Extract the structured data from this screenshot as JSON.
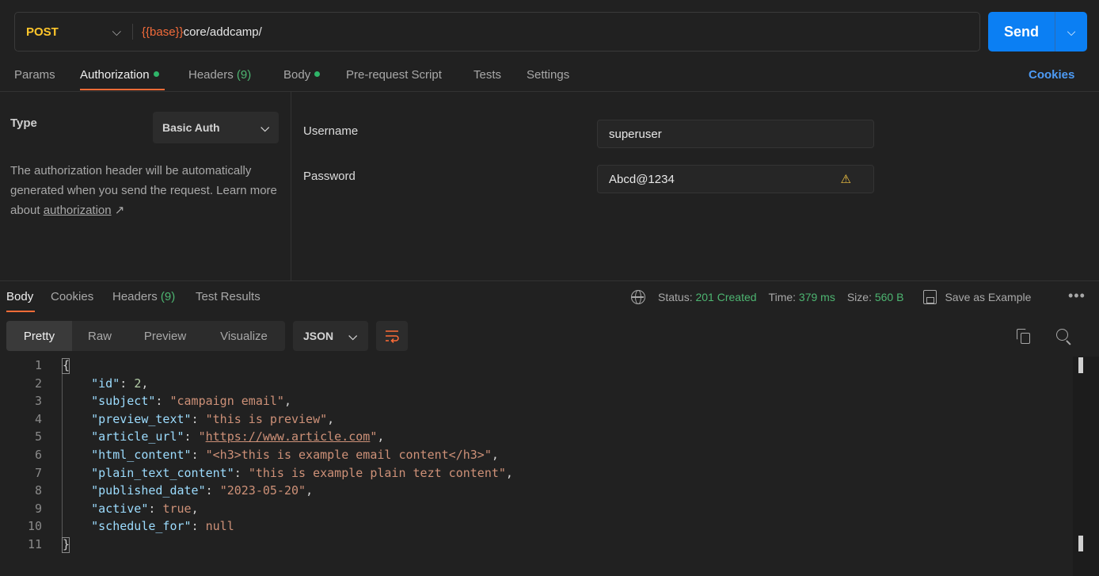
{
  "request": {
    "method": "POST",
    "url_var": "{{base}}",
    "url_path": "core/addcamp/",
    "send_label": "Send"
  },
  "req_tabs": {
    "params": "Params",
    "authorization": "Authorization",
    "headers": "Headers",
    "headers_count": "(9)",
    "body": "Body",
    "prerequest": "Pre-request Script",
    "tests": "Tests",
    "settings": "Settings",
    "cookies": "Cookies"
  },
  "auth": {
    "type_label": "Type",
    "type_value": "Basic Auth",
    "desc_text": "The authorization header will be automatically generated when you send the request. Learn more about",
    "desc_link": "authorization",
    "desc_arrow": "↗",
    "username_label": "Username",
    "username_value": "superuser",
    "password_label": "Password",
    "password_value": "Abcd@1234"
  },
  "res_tabs": {
    "body": "Body",
    "cookies": "Cookies",
    "headers": "Headers",
    "headers_count": "(9)",
    "test_results": "Test Results"
  },
  "response_meta": {
    "status_label": "Status:",
    "status_value": "201 Created",
    "time_label": "Time:",
    "time_value": "379 ms",
    "size_label": "Size:",
    "size_value": "560 B",
    "save_example": "Save as Example",
    "more": "•••"
  },
  "format": {
    "pretty": "Pretty",
    "raw": "Raw",
    "preview": "Preview",
    "visualize": "Visualize",
    "language": "JSON"
  },
  "code": {
    "line_numbers": [
      "1",
      "2",
      "3",
      "4",
      "5",
      "6",
      "7",
      "8",
      "9",
      "10",
      "11"
    ],
    "open_brace": "{",
    "close_brace": "}",
    "lines": [
      {
        "key": "\"id\"",
        "value": "2",
        "vtype": "n"
      },
      {
        "key": "\"subject\"",
        "value": "\"campaign email\"",
        "vtype": "s"
      },
      {
        "key": "\"preview_text\"",
        "value": "\"this is preview\"",
        "vtype": "s"
      },
      {
        "key": "\"article_url\"",
        "value": "https://www.article.com",
        "vtype": "url"
      },
      {
        "key": "\"html_content\"",
        "value": "\"<h3>this is example email content</h3>\"",
        "vtype": "s"
      },
      {
        "key": "\"plain_text_content\"",
        "value": "\"this is example plain tezt content\"",
        "vtype": "s"
      },
      {
        "key": "\"published_date\"",
        "value": "\"2023-05-20\"",
        "vtype": "s"
      },
      {
        "key": "\"active\"",
        "value": "true",
        "vtype": "b"
      },
      {
        "key": "\"schedule_for\"",
        "value": "null",
        "vtype": "nl"
      }
    ]
  },
  "colors": {
    "accent": "#ff6c37",
    "send_blue": "#0b7ff3",
    "method_yellow": "#ffc62b",
    "status_green": "#4db571",
    "json_key": "#9cdcfe",
    "json_string": "#ce9178"
  }
}
